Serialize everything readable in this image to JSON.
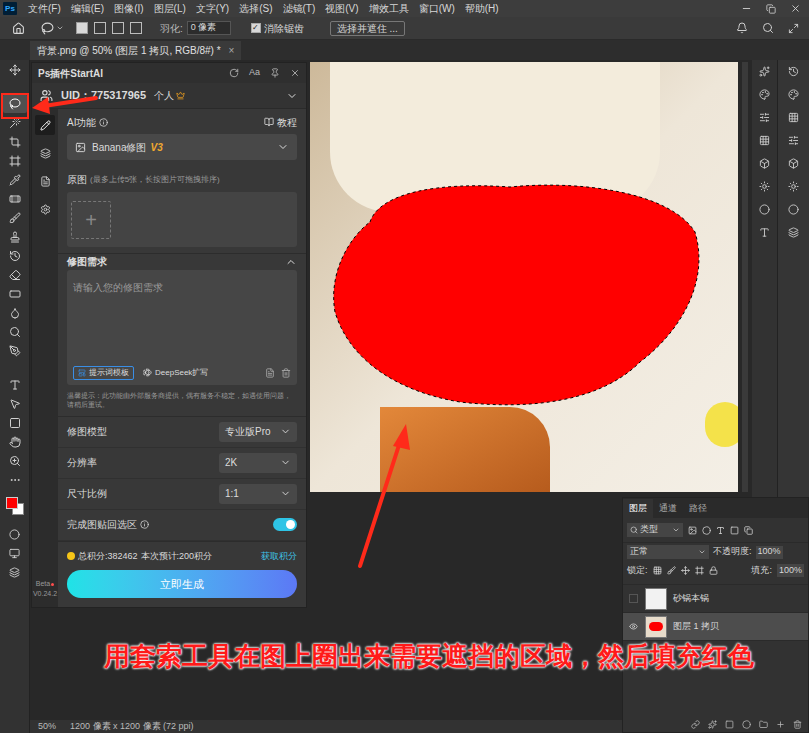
{
  "app": {
    "logo": "Ps"
  },
  "menu": [
    "文件(F)",
    "编辑(E)",
    "图像(I)",
    "图层(L)",
    "文字(Y)",
    "选择(S)",
    "滤镜(T)",
    "视图(V)",
    "增效工具",
    "窗口(W)",
    "帮助(H)"
  ],
  "options_bar": {
    "feather_label": "羽化:",
    "feather_value": "0 像素",
    "antialias": {
      "label": "消除锯齿",
      "checked": true
    },
    "select_mask": "选择并遮住 ..."
  },
  "document_tab": {
    "title": "背景.png @ 50% (图层 1 拷贝, RGB/8#) *",
    "close": "×"
  },
  "tools": [
    {
      "tool": "move",
      "selected": false
    },
    {
      "tool": "lasso",
      "selected": true
    },
    {
      "tool": "wand",
      "selected": false
    },
    {
      "tool": "crop",
      "selected": false
    },
    {
      "tool": "frame",
      "selected": false
    },
    {
      "tool": "eyedropper",
      "selected": false
    },
    {
      "tool": "healing",
      "selected": false
    },
    {
      "tool": "brush",
      "selected": false
    },
    {
      "tool": "stamp",
      "selected": false
    },
    {
      "tool": "history",
      "selected": false
    },
    {
      "tool": "eraser",
      "selected": false
    },
    {
      "tool": "gradient",
      "selected": false
    },
    {
      "tool": "blur",
      "selected": false
    },
    {
      "tool": "dodge",
      "selected": false
    },
    {
      "tool": "pen",
      "selected": false
    },
    {
      "tool": "type",
      "selected": false
    },
    {
      "tool": "path",
      "selected": false
    },
    {
      "tool": "shape",
      "selected": false
    },
    {
      "tool": "hand",
      "selected": false
    },
    {
      "tool": "zoom",
      "selected": false
    },
    {
      "tool": "more",
      "selected": false
    }
  ],
  "colors": {
    "foreground": "#ff0000",
    "background": "#ffffff"
  },
  "plugin": {
    "title": "Ps插件StartAI",
    "font_button": "Aa",
    "uid": "UID：775317965",
    "plan": "个人",
    "sidebar": [
      {
        "icon": "edit",
        "selected": true
      },
      {
        "icon": "layers",
        "selected": false
      },
      {
        "icon": "doc",
        "selected": false
      },
      {
        "icon": "settings",
        "selected": false
      }
    ],
    "beta": "Beta",
    "version": "V0.24.2",
    "ai_label": "AI功能",
    "tutorial": "教程",
    "function": {
      "name": "Banana修图",
      "version": "V3"
    },
    "source": {
      "label": "原图",
      "hint": "(最多上传5张，长按图片可拖拽排序)",
      "add": "+"
    },
    "request": {
      "label": "修图需求",
      "expanded": true,
      "placeholder": "请输入您的修图需求",
      "template_button": "提示词模板",
      "expand_button": "DeepSeek扩写"
    },
    "notice": "温馨提示：此功能由外部服务商提供，偶有服务不稳定，如遇使用问题，请稍后重试。",
    "settings": [
      {
        "label": "修图模型",
        "kind": "select",
        "value": "专业版Pro",
        "on": false
      },
      {
        "label": "分辨率",
        "kind": "select",
        "value": "2K",
        "on": false
      },
      {
        "label": "尺寸比例",
        "kind": "select",
        "value": "1:1",
        "on": false
      },
      {
        "label": "完成图贴回选区",
        "kind": "toggle",
        "value": "",
        "on": true
      }
    ],
    "points": {
      "total": "总积分:382462",
      "estimate": "本次预计:200积分",
      "get": "获取积分"
    },
    "generate": "立即生成"
  },
  "layers_panel": {
    "tabs": [
      {
        "label": "图层",
        "selected": true
      },
      {
        "label": "通道",
        "selected": false
      },
      {
        "label": "路径",
        "selected": false
      }
    ],
    "filter": "类型",
    "blend": "正常",
    "opacity_label": "不透明度:",
    "opacity": "100%",
    "lock_label": "锁定:",
    "fill_label": "填充:",
    "fill": "100%",
    "layers": [
      {
        "name": "砂锅本锅",
        "visible": false,
        "selected": false
      },
      {
        "name": "图层 1 拷贝",
        "visible": true,
        "selected": true
      }
    ]
  },
  "status_bar": {
    "zoom": "50%",
    "size": "1200 像素 x 1200 像素 (72 ppi)"
  },
  "annotation": {
    "caption": "用套索工具在图上圈出来需要遮挡的区域，然后填充红色"
  }
}
